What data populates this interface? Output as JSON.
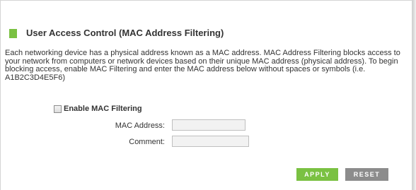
{
  "section": {
    "title": "User Access Control (MAC Address Filtering)",
    "description": "Each networking device has a physical address known as a MAC address. MAC Address Filtering blocks access to your network from computers or network devices based on their unique MAC address (physical address). To begin blocking access, enable MAC Filtering and enter the MAC address below without spaces or symbols (i.e. A1B2C3D4E5F6)"
  },
  "form": {
    "enable_label": "Enable MAC Filtering",
    "enable_checked": false,
    "mac_label": "MAC Address:",
    "mac_value": "",
    "comment_label": "Comment:",
    "comment_value": ""
  },
  "buttons": {
    "apply": "APPLY",
    "reset": "RESET"
  },
  "colors": {
    "accent": "#7ac142",
    "reset_button": "#8c8c8c"
  }
}
